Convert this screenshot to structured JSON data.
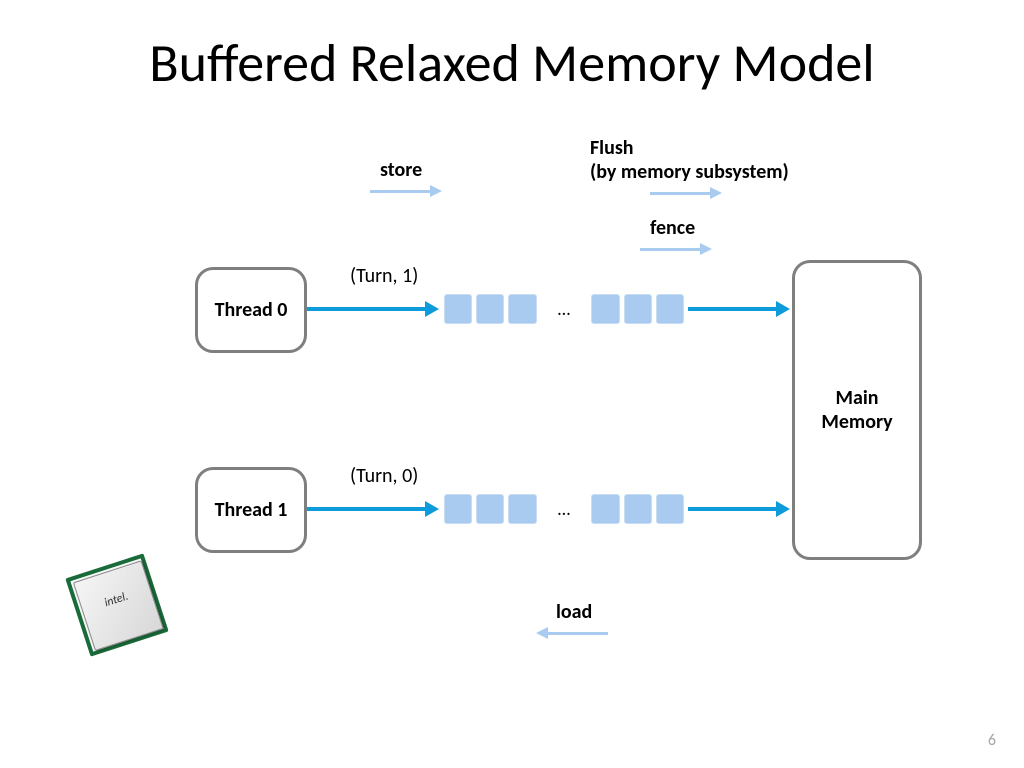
{
  "title": "Buffered Relaxed Memory Model",
  "labels": {
    "store": "store",
    "flush": "Flush\n(by memory subsystem)",
    "fence": "fence",
    "load": "load",
    "turn1": "(Turn, 1)",
    "turn0": "(Turn, 0)",
    "thread0": "Thread 0",
    "thread1": "Thread 1",
    "main_memory": "Main\nMemory",
    "ellipsis": "…",
    "chip": "intel."
  },
  "page_number": "6"
}
